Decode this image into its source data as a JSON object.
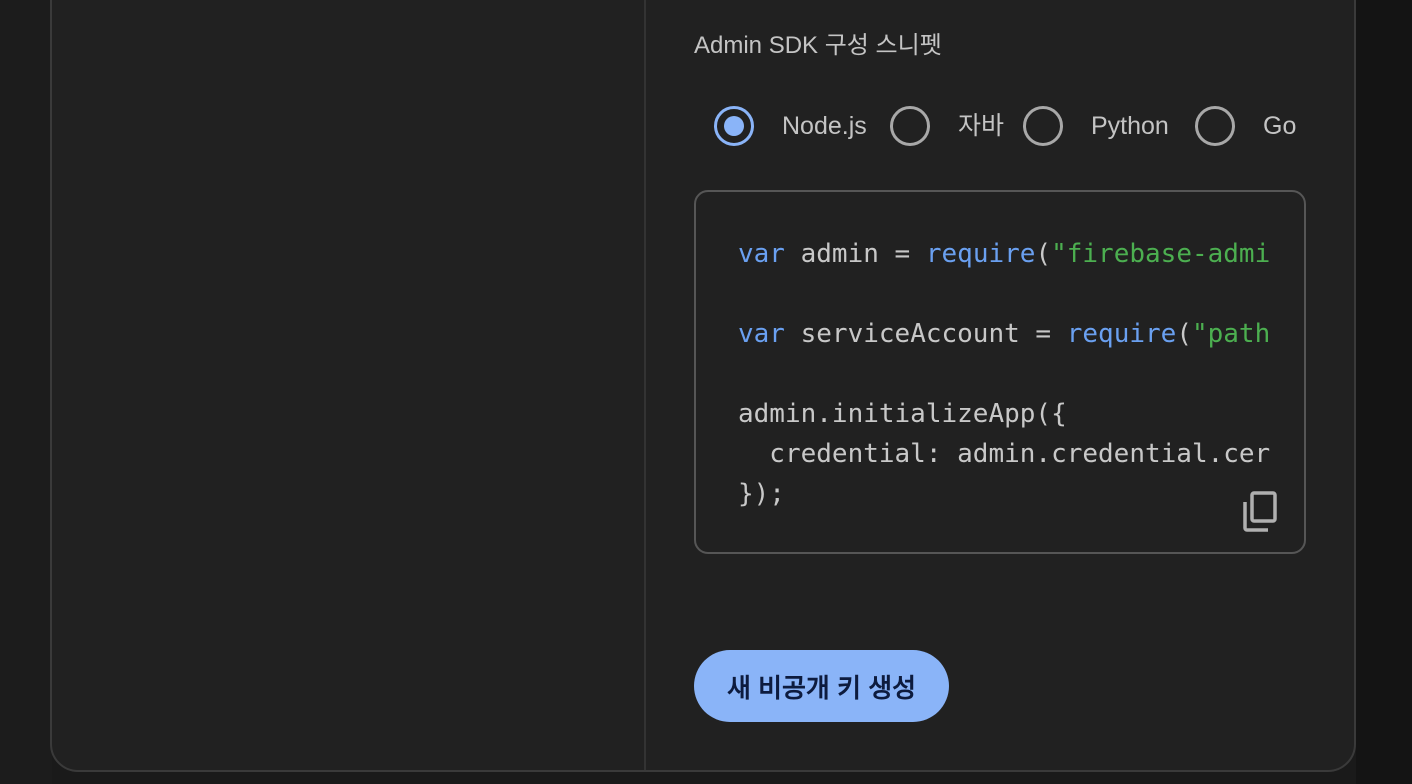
{
  "section": {
    "title": "Admin SDK 구성 스니펫"
  },
  "language_options": [
    {
      "label": "Node.js",
      "selected": true
    },
    {
      "label": "자바",
      "selected": false
    },
    {
      "label": "Python",
      "selected": false
    },
    {
      "label": "Go",
      "selected": false
    }
  ],
  "code": {
    "line1": {
      "kw": "var",
      "mid": " admin = ",
      "fn": "require",
      "paren": "(",
      "str": "\"firebase-admi"
    },
    "line2": {
      "kw": "var",
      "mid": " serviceAccount = ",
      "fn": "require",
      "paren": "(",
      "str": "\"path"
    },
    "line3": "admin.initializeApp({",
    "line4": "  credential: admin.credential.cer",
    "line5": "});"
  },
  "copy_icon": "copy-icon",
  "generate_button": {
    "label": "새 비공개 키 생성"
  },
  "colors": {
    "accent": "#8ab4f8",
    "keyword": "#6aa0f0",
    "string": "#4caf50",
    "surface": "#212121"
  }
}
